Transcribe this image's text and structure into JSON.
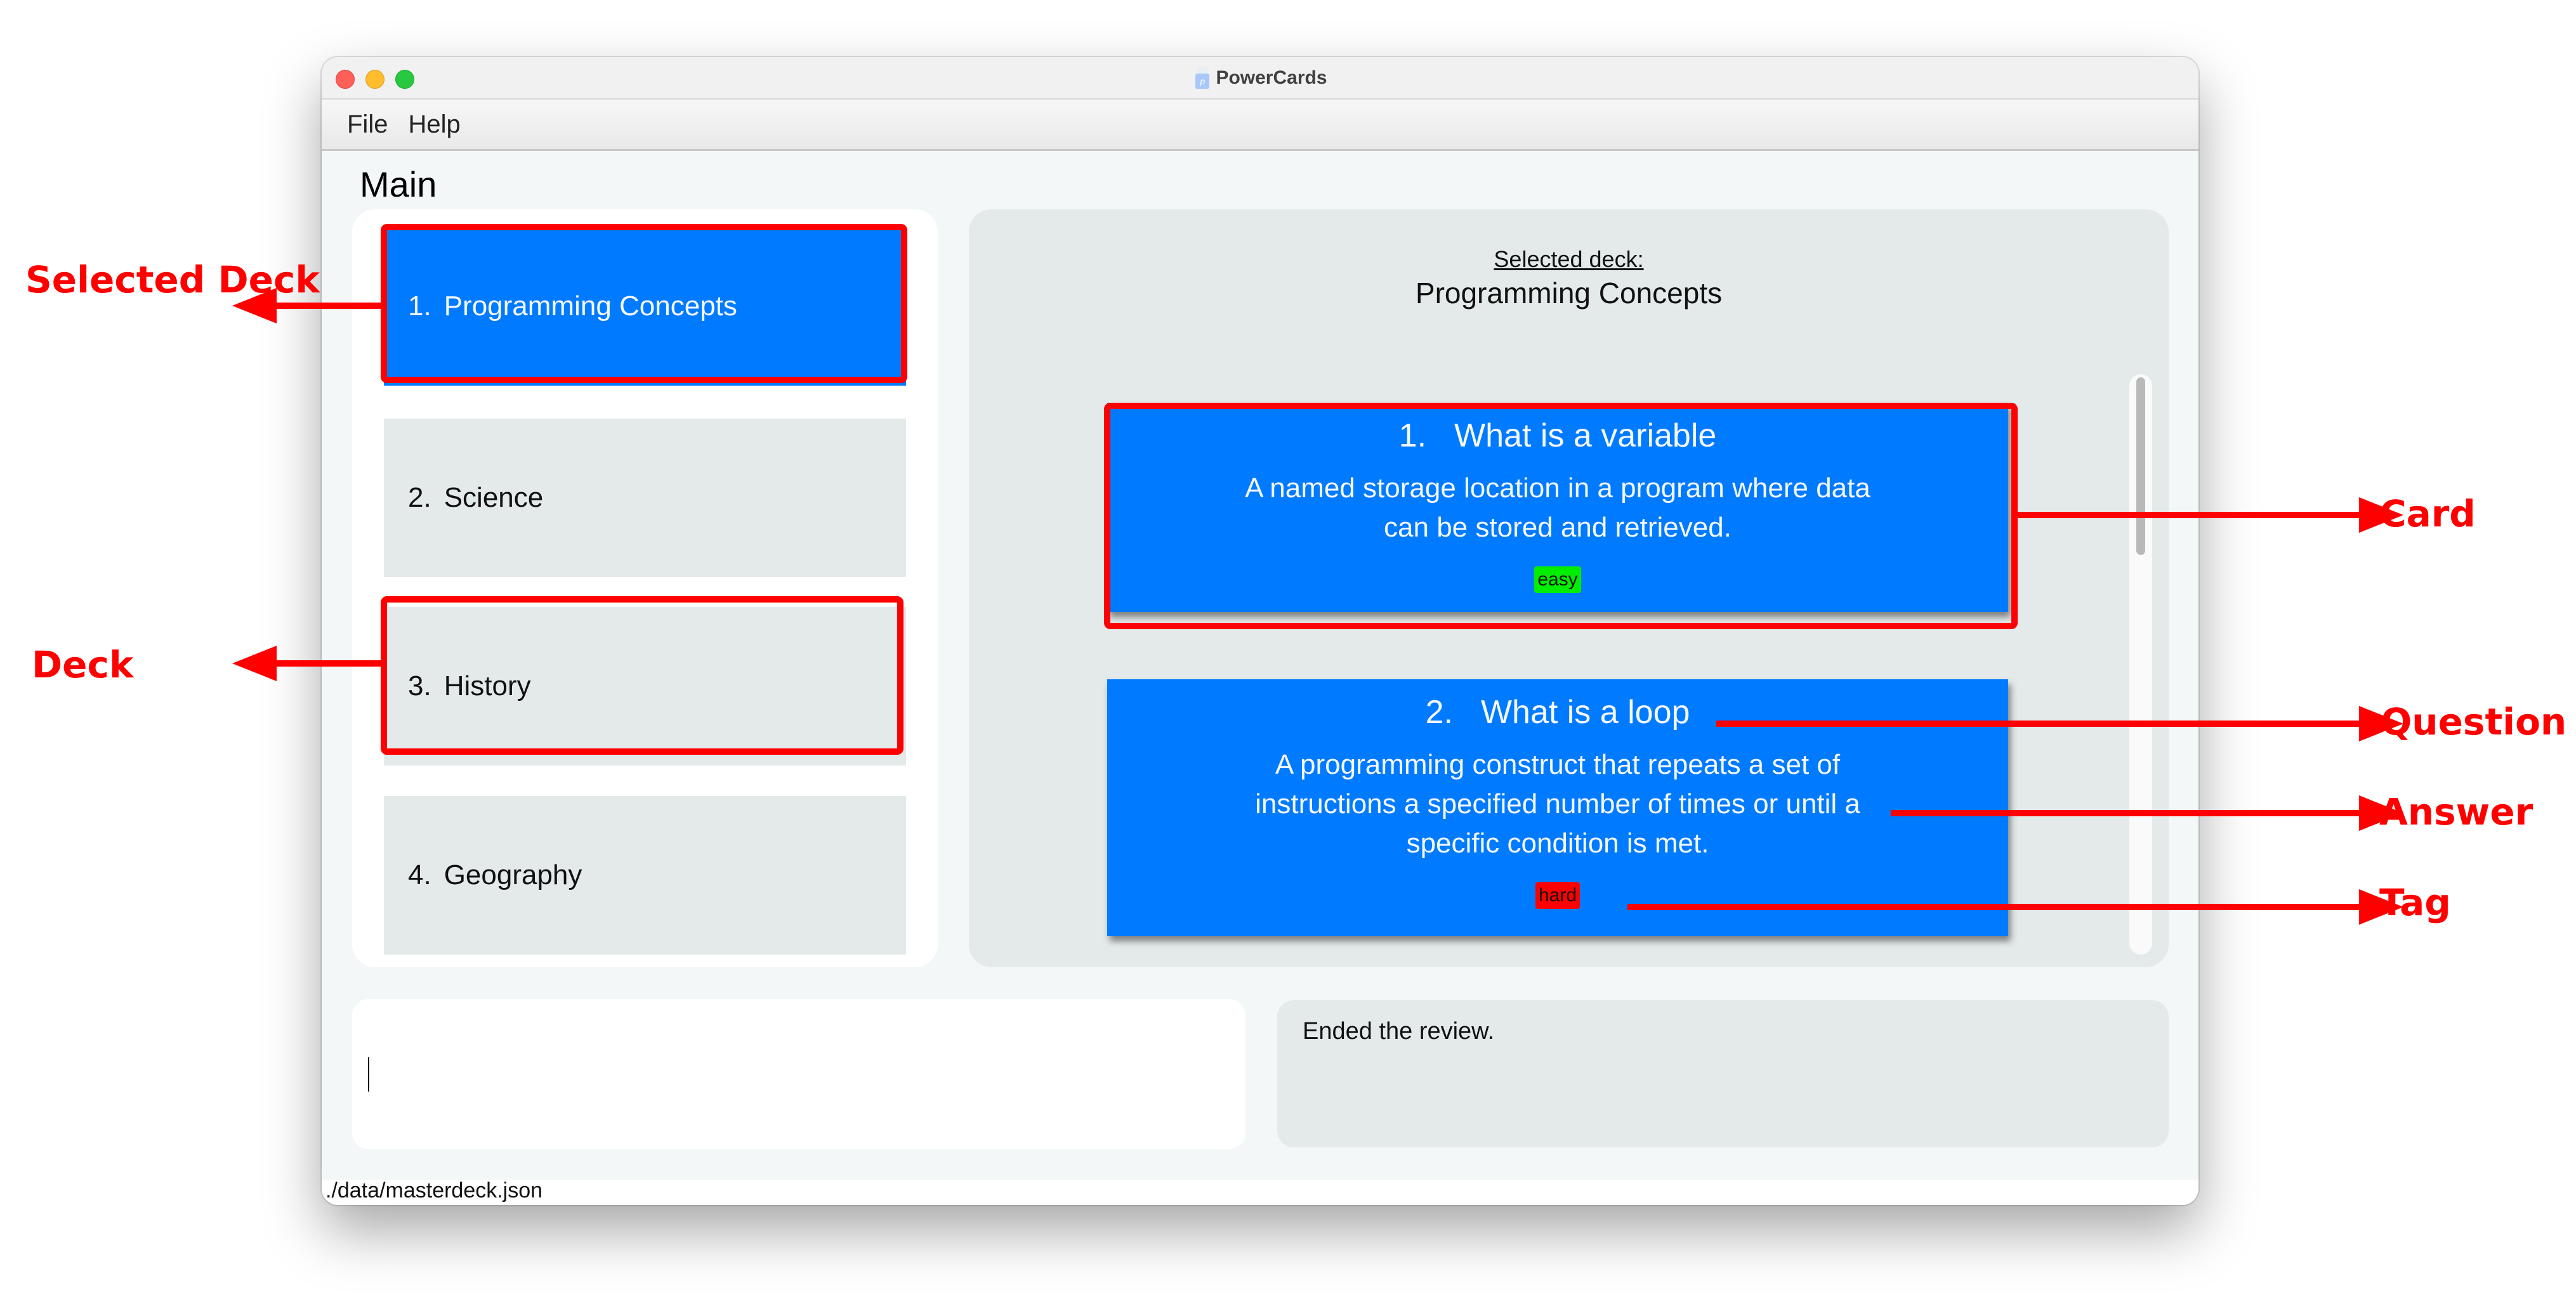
{
  "window": {
    "title": "PowerCards",
    "app_icon": "powercards-logo-icon",
    "traffic_lights": [
      "close",
      "minimize",
      "maximize"
    ]
  },
  "menu": {
    "items": [
      {
        "label": "File"
      },
      {
        "label": "Help"
      }
    ]
  },
  "main": {
    "section_label": "Main",
    "decks": [
      {
        "index": "1.",
        "name": "Programming Concepts",
        "selected": true
      },
      {
        "index": "2.",
        "name": "Science",
        "selected": false
      },
      {
        "index": "3.",
        "name": "History",
        "selected": false
      },
      {
        "index": "4.",
        "name": "Geography",
        "selected": false
      }
    ],
    "selected_deck_label": "Selected deck:",
    "selected_deck_name": "Programming Concepts",
    "cards": [
      {
        "index": "1.",
        "question": "What is a variable",
        "answer": "A named storage location in a program where data can be stored and retrieved.",
        "tag": "easy",
        "tag_color": "#00ee00"
      },
      {
        "index": "2.",
        "question": "What is a loop",
        "answer": "A programming construct that repeats a set of instructions a specified number of times or until a specific condition is met.",
        "tag": "hard",
        "tag_color": "#ff0000"
      }
    ]
  },
  "command": {
    "value": "",
    "placeholder": ""
  },
  "result": {
    "text": "Ended the review."
  },
  "status_bar": {
    "file_path": "./data/masterdeck.json"
  },
  "colors": {
    "accent": "#007aff",
    "deck_unselected": "#e4eaea",
    "annotation": "#ff0000"
  },
  "annotations": {
    "selected_deck": "Selected Deck",
    "deck": "Deck",
    "card": "Card",
    "question": "Question",
    "answer": "Answer",
    "tag": "Tag"
  }
}
